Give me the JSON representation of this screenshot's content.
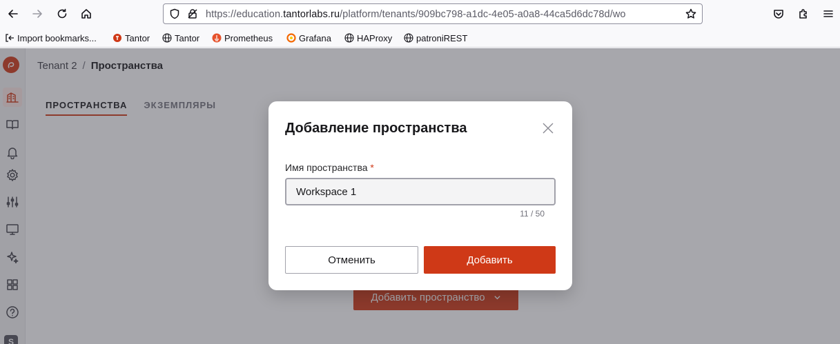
{
  "browser": {
    "url_prefix": "https://education.",
    "url_domain": "tantorlabs.ru",
    "url_path": "/platform/tenants/909bc798-a1dc-4e05-a0a8-44ca5d6dc78d/wo"
  },
  "bookmarks": [
    {
      "label": "Import bookmarks...",
      "icon": "import-icon"
    },
    {
      "label": "Tantor",
      "icon": "tantor-icon"
    },
    {
      "label": "Tantor",
      "icon": "globe-icon"
    },
    {
      "label": "Prometheus",
      "icon": "prometheus-icon"
    },
    {
      "label": "Grafana",
      "icon": "grafana-icon"
    },
    {
      "label": "HAProxy",
      "icon": "globe-icon"
    },
    {
      "label": "patroniREST",
      "icon": "globe-icon"
    }
  ],
  "breadcrumb": {
    "tenant": "Tenant 2",
    "separator": "/",
    "current": "Пространства"
  },
  "tabs": [
    {
      "label": "ПРОСТРАНСТВА",
      "active": true
    },
    {
      "label": "ЭКЗЕМПЛЯРЫ",
      "active": false
    }
  ],
  "add_workspace_button": "Добавить пространство",
  "modal": {
    "title": "Добавление пространства",
    "field_label": "Имя пространства",
    "required_mark": "*",
    "field_value": "Workspace 1",
    "counter": "11 / 50",
    "cancel_label": "Отменить",
    "add_label": "Добавить"
  },
  "colors": {
    "accent": "#cf3917",
    "overlay": "rgba(60,60,70,0.45)"
  },
  "sidebar_icons": [
    "logo-icon",
    "buildings-icon",
    "book-icon",
    "bell-icon",
    "settings-icon",
    "sliders-icon",
    "monitor-icon",
    "sparkle-icon",
    "grid-icon",
    "help-icon",
    "avatar-s"
  ]
}
